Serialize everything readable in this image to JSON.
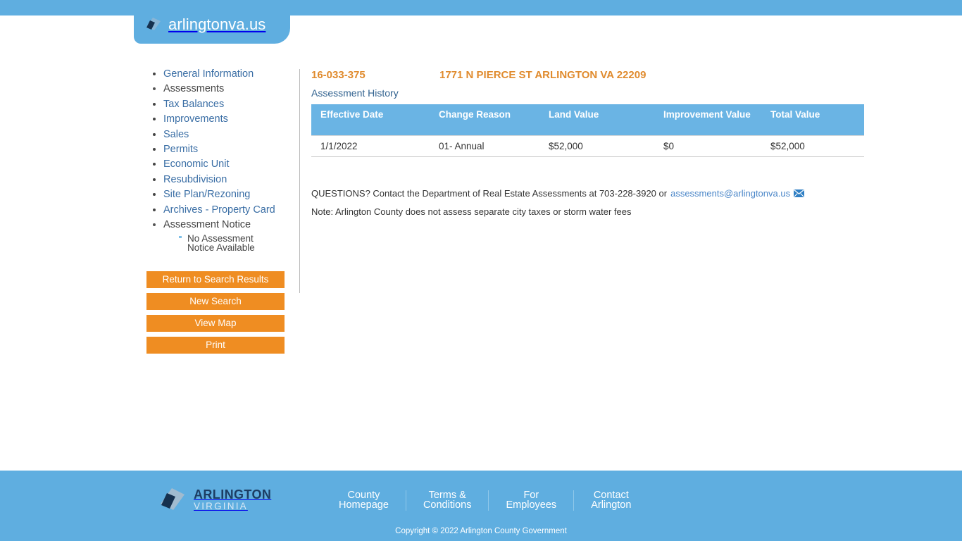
{
  "header": {
    "brand": "arlingtonva.us",
    "logo_icon": "arlington-diamond-logo"
  },
  "sidebar": {
    "items": [
      {
        "label": "General Information",
        "active": false
      },
      {
        "label": "Assessments",
        "active": true
      },
      {
        "label": "Tax Balances",
        "active": false
      },
      {
        "label": "Improvements",
        "active": false
      },
      {
        "label": "Sales",
        "active": false
      },
      {
        "label": "Permits",
        "active": false
      },
      {
        "label": "Economic Unit",
        "active": false
      },
      {
        "label": "Resubdivision",
        "active": false
      },
      {
        "label": "Site Plan/Rezoning",
        "active": false
      },
      {
        "label": "Archives - Property Card",
        "active": false
      },
      {
        "label": "Assessment Notice",
        "active": true
      }
    ],
    "sub_items": [
      {
        "label": "No Assessment Notice Available"
      }
    ],
    "buttons": [
      {
        "label": "Return to Search Results"
      },
      {
        "label": "New Search"
      },
      {
        "label": "View Map"
      },
      {
        "label": "Print"
      }
    ]
  },
  "main": {
    "record_id": "16-033-375",
    "address": "1771 N PIERCE ST ARLINGTON VA 22209",
    "section_title": "Assessment History",
    "table": {
      "headers": [
        "Effective Date",
        "Change Reason",
        "Land Value",
        "Improvement Value",
        "Total Value"
      ],
      "rows": [
        [
          "1/1/2022",
          "01- Annual",
          "$52,000",
          "$0",
          "$52,000"
        ]
      ]
    },
    "notes": {
      "questions_prefix": "QUESTIONS? Contact the Department of Real Estate Assessments at 703-228-3920 or ",
      "email": "assessments@arlingtonva.us",
      "mail_icon": "envelope-icon",
      "disclaimer": "Note: Arlington County does not assess separate city taxes or storm water fees"
    }
  },
  "footer": {
    "logo_icon": "arlington-diamond-logo",
    "logo_title": "ARLINGTON",
    "logo_subtitle": "VIRGINIA",
    "links": [
      {
        "label": "County\nHomepage"
      },
      {
        "label": "Terms &\nConditions"
      },
      {
        "label": "For\nEmployees"
      },
      {
        "label": "Contact\nArlington"
      }
    ],
    "copyright": "Copyright © 2022 Arlington County Government"
  },
  "colors": {
    "brand_blue": "#5faee0",
    "table_header_blue": "#6ab4e4",
    "accent_orange": "#ef8d22",
    "record_orange": "#e08b2e",
    "link_blue": "#3a6ea5",
    "logo_navy": "#1c3d63"
  }
}
